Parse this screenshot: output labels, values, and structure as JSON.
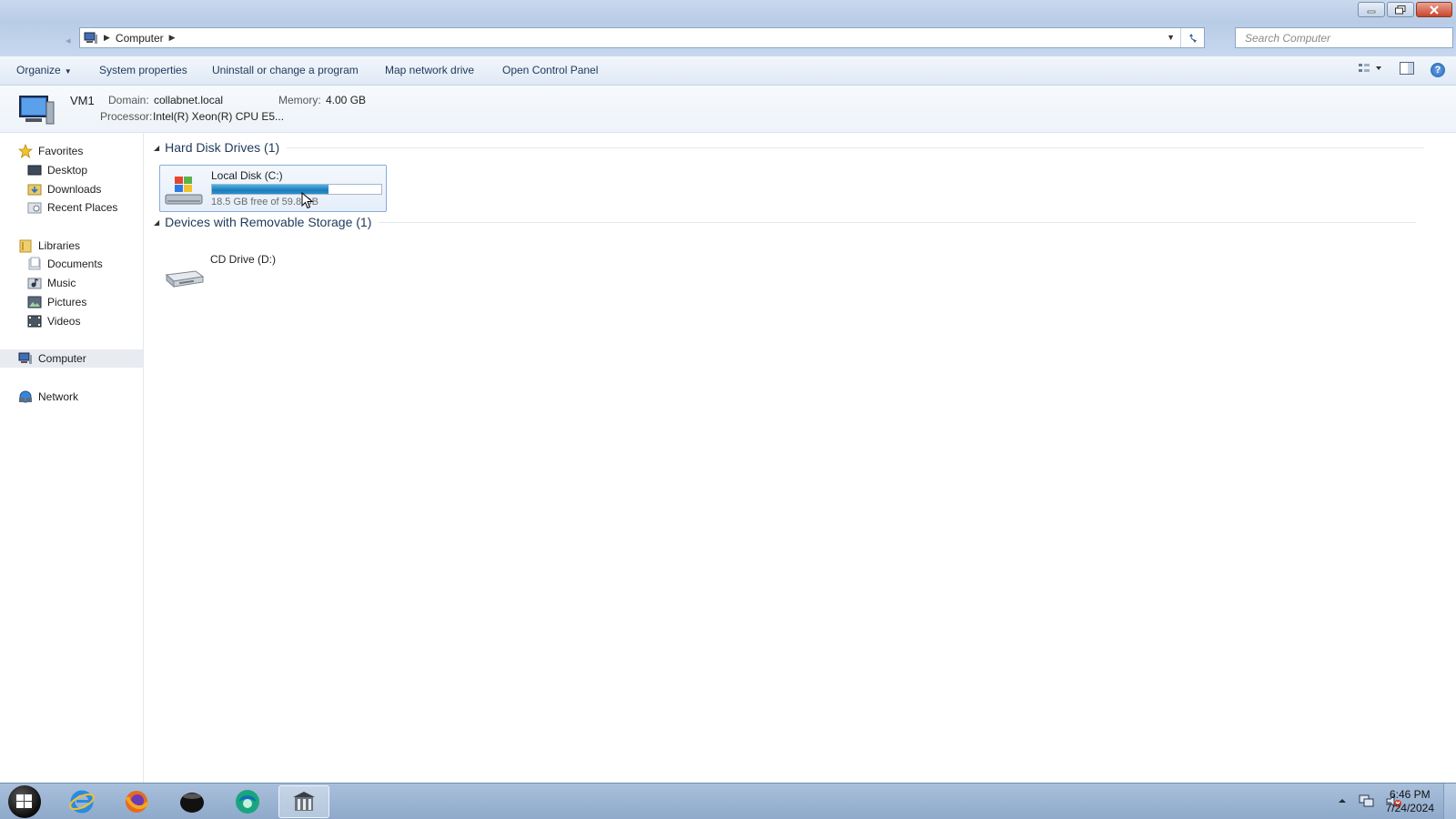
{
  "window": {
    "address_crumbs": [
      "Computer"
    ],
    "search_placeholder": "Search Computer"
  },
  "commandbar": {
    "organize": "Organize",
    "system_properties": "System properties",
    "uninstall": "Uninstall or change a program",
    "map_drive": "Map network drive",
    "control_panel": "Open Control Panel"
  },
  "details": {
    "name": "VM1",
    "domain_label": "Domain:",
    "domain_value": "collabnet.local",
    "memory_label": "Memory:",
    "memory_value": "4.00 GB",
    "processor_label": "Processor:",
    "processor_value": "Intel(R) Xeon(R) CPU E5..."
  },
  "sidebar": {
    "favorites": "Favorites",
    "desktop": "Desktop",
    "downloads": "Downloads",
    "recent_places": "Recent Places",
    "libraries": "Libraries",
    "documents": "Documents",
    "music": "Music",
    "pictures": "Pictures",
    "videos": "Videos",
    "computer": "Computer",
    "network": "Network"
  },
  "groups": {
    "hdd_title": "Hard Disk Drives (1)",
    "removable_title": "Devices with Removable Storage (1)"
  },
  "drives": {
    "c_name": "Local Disk (C:)",
    "c_free": "18.5 GB free of 59.8 GB",
    "c_used_fraction": 0.69,
    "d_name": "CD Drive (D:)"
  },
  "taskbar": {
    "time": "6:46 PM",
    "date": "7/24/2024"
  },
  "colors": {
    "accent": "#1e395b",
    "bar_fill": "#1b7bb8"
  }
}
